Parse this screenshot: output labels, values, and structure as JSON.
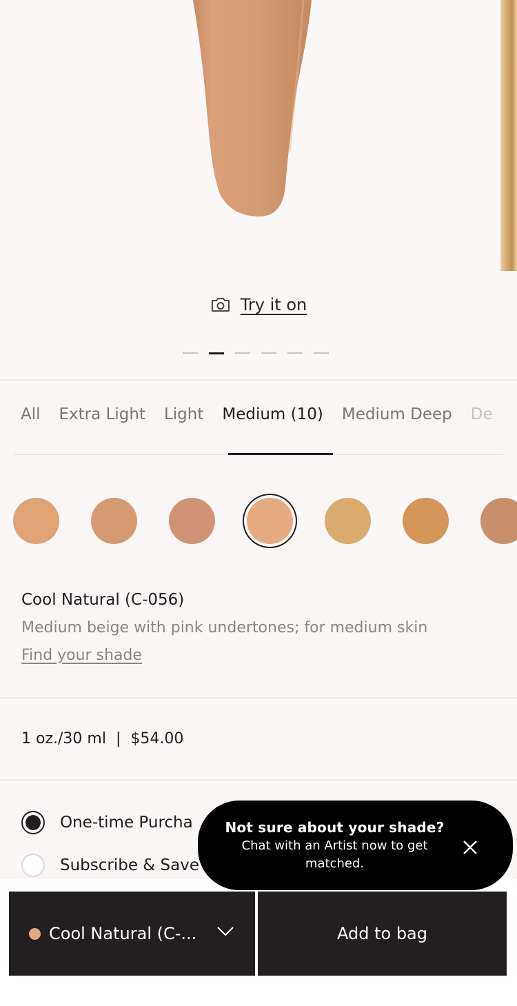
{
  "gallery": {
    "try_on_label": "Try it on",
    "page_count": 6,
    "current_page": 2,
    "drip_color": "#d29a74"
  },
  "categories": {
    "tabs": [
      {
        "label": "All"
      },
      {
        "label": "Extra Light"
      },
      {
        "label": "Light"
      },
      {
        "label": "Medium (10)",
        "active": true
      },
      {
        "label": "Medium Deep"
      },
      {
        "label": "De"
      }
    ]
  },
  "swatches": [
    {
      "color": "#dfa376"
    },
    {
      "color": "#d69a73"
    },
    {
      "color": "#d29374"
    },
    {
      "color": "#e6aa80",
      "selected": true
    },
    {
      "color": "#dbab6f"
    },
    {
      "color": "#d5965a"
    },
    {
      "color": "#c98f6b"
    }
  ],
  "shade": {
    "name": "Cool Natural (C-056)",
    "description": "Medium beige with pink undertones; for medium skin",
    "find_link": "Find your shade"
  },
  "product": {
    "size": "1 oz./30 ml",
    "separator": "|",
    "price": "$54.00"
  },
  "purchase_options": [
    {
      "label": "One-time Purcha",
      "checked": true
    },
    {
      "label": "Subscribe & Save",
      "checked": false
    }
  ],
  "chat": {
    "headline": "Not sure about your shade?",
    "message": "Chat with an Artist now to get matched."
  },
  "footer": {
    "selected_shade": "Cool Natural (C-...",
    "selected_color": "#e0a97f",
    "add_to_bag": "Add to bag"
  }
}
